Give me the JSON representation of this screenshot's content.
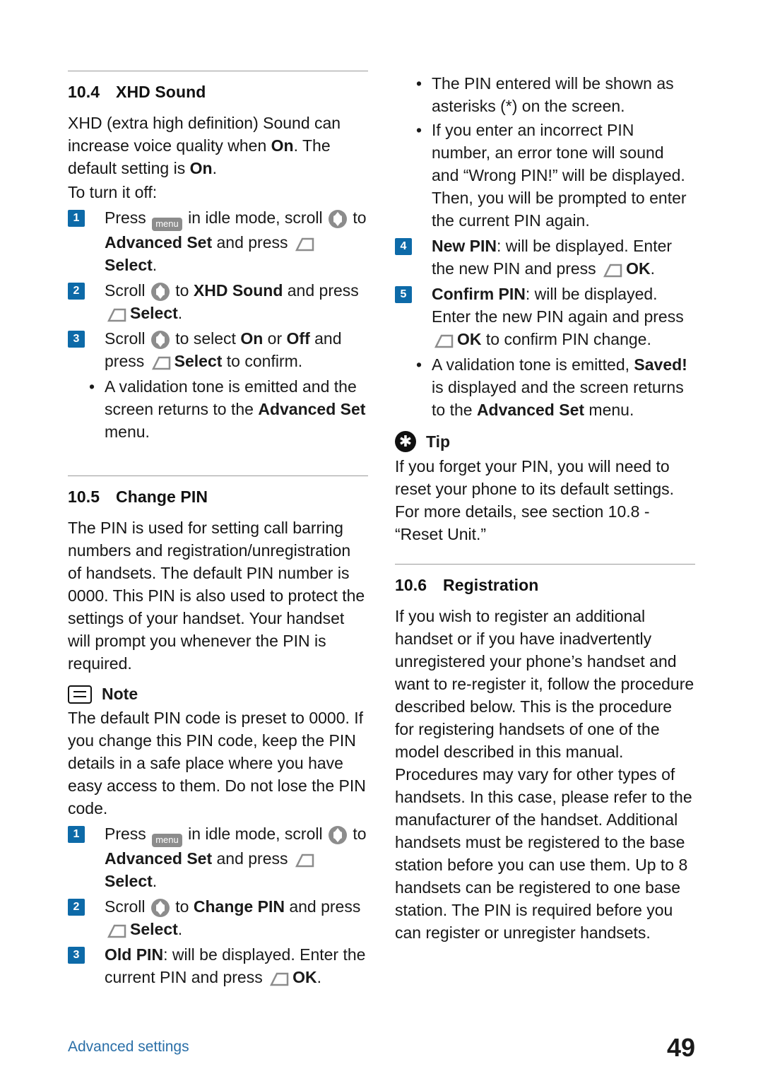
{
  "page": {
    "number": "49",
    "footer_label": "Advanced settings"
  },
  "left": {
    "s104": {
      "number": "10.4",
      "title": "XHD Sound",
      "intro_1": "XHD (extra high definition) Sound can increase voice quality when ",
      "intro_on": "On",
      "intro_2": ". The default setting is ",
      "intro_on2": "On",
      "intro_3": ".",
      "intro_4": "To turn it off:",
      "steps": [
        {
          "num": "1",
          "pre": "Press ",
          "mid": " in idle mode, scroll ",
          "post": " to ",
          "bold1": "Advanced Set",
          "tail1": " and press ",
          "bold2": "Select",
          "tail2": "."
        },
        {
          "num": "2",
          "pre": "Scroll ",
          "mid": " to ",
          "bold1": "XHD Sound",
          "tail1": " and press ",
          "bold2": "Select",
          "tail2": "."
        },
        {
          "num": "3",
          "pre": "Scroll ",
          "mid": " to select ",
          "bold1": "On",
          "mid2": " or ",
          "bold2": "Off",
          "tail1": " and press ",
          "bold3": "Select",
          "tail2": " to confirm."
        }
      ],
      "bullet": {
        "text1": "A validation tone is emitted and the screen returns to the ",
        "bold": "Advanced Set",
        "text2": " menu."
      }
    },
    "s105": {
      "number": "10.5",
      "title": "Change PIN",
      "para": "The PIN is used for setting call barring numbers and registration/unregistration of handsets. The default PIN number is 0000. This PIN is also used to protect the settings of your handset. Your handset will prompt you whenever the PIN is required.",
      "note_label": "Note",
      "note_text": "The default PIN code is preset to 0000. If you change this PIN code, keep the PIN details in a safe place where you have easy access to them. Do not lose the PIN code.",
      "steps": [
        {
          "num": "1",
          "pre": "Press ",
          "mid": " in idle mode, scroll ",
          "post": " to ",
          "bold1": "Advanced Set",
          "tail1": " and press ",
          "bold2": "Select",
          "tail2": "."
        },
        {
          "num": "2",
          "pre": "Scroll ",
          "mid": " to ",
          "bold1": "Change PIN",
          "tail1": " and press ",
          "bold2": "Select",
          "tail2": "."
        },
        {
          "num": "3",
          "bold1": "Old PIN",
          "tail1": ": will be displayed. Enter the current PIN and press ",
          "bold2": "OK",
          "tail2": "."
        }
      ]
    }
  },
  "right": {
    "bullets_top": [
      {
        "text": "The PIN entered will be shown as asterisks (*) on the screen."
      },
      {
        "text": "If you enter an incorrect PIN number, an error tone will sound and “Wrong PIN!” will be displayed. Then, you will be prompted to enter the current PIN again."
      }
    ],
    "steps": [
      {
        "num": "4",
        "bold1": "New PIN",
        "tail1": ": will be displayed. Enter the new PIN and press ",
        "bold2": "OK",
        "tail2": "."
      },
      {
        "num": "5",
        "bold1": "Confirm PIN",
        "tail1": ": will be displayed. Enter the new PIN again and press ",
        "bold2": "OK",
        "tail2": " to confirm PIN change."
      }
    ],
    "bullet_saved": {
      "text1": "A validation tone is emitted, ",
      "bold1": "Saved!",
      "text2": " is displayed and the screen returns to the ",
      "bold2": "Advanced Set",
      "text3": " menu."
    },
    "tip": {
      "label": "Tip",
      "text": "If you forget your PIN, you will need to reset your phone to its default settings. For more details, see section 10.8 - “Reset Unit.”"
    },
    "s106": {
      "number": "10.6",
      "title": "Registration",
      "para": "If you wish to register an additional handset or if you have inadvertently unregistered your phone’s handset and want to re-register it, follow the procedure described below. This is the procedure for registering handsets of one of the model described in this manual. Procedures may vary for other types of handsets. In this case, please refer to the manufacturer of the handset. Additional handsets must be registered to the base station before you can use them. Up to 8 handsets can be registered to one base station. The PIN is required before you can register or unregister handsets."
    }
  },
  "icons": {
    "menu_key": "menu",
    "nav_key": "nav-key-icon",
    "soft_key": "soft-key-icon"
  },
  "colors": {
    "accent": "#0d6aa8",
    "footer": "#2a6fa8",
    "key_gray": "#8c8c8c"
  }
}
